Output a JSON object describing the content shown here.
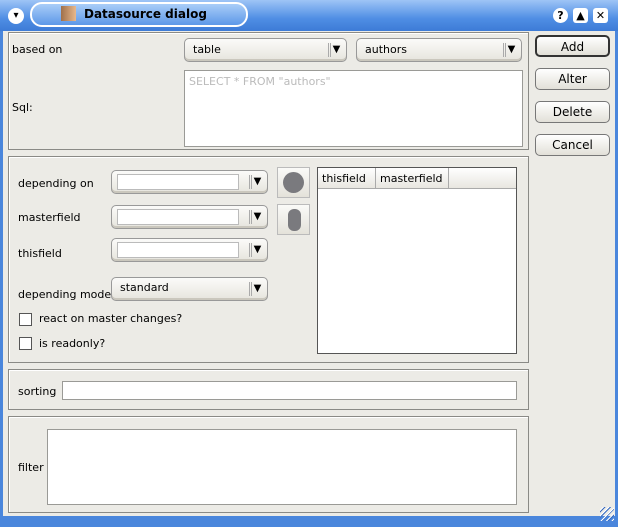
{
  "window": {
    "title": "Datasource dialog",
    "help": "?",
    "maximize": "▲",
    "close": "✕",
    "menu": "▾"
  },
  "top": {
    "based_on_label": "based on",
    "source_type": "table",
    "source_name": "authors",
    "sql_label": "Sql:",
    "sql_placeholder": "SELECT * FROM \"authors\""
  },
  "buttons": {
    "add": "Add",
    "alter": "Alter",
    "delete": "Delete",
    "cancel": "Cancel"
  },
  "relation": {
    "depending_on_label": "depending on",
    "depending_on": "",
    "masterfield_label": "masterfield",
    "masterfield": "",
    "thisfield_label": "thisfield",
    "thisfield": "",
    "mode_label": "depending mode",
    "mode": "standard",
    "react_label": "react on master changes?",
    "react_checked": false,
    "readonly_label": "is readonly?",
    "readonly_checked": false,
    "table_headers": [
      "thisfield",
      "masterfield"
    ]
  },
  "sorting": {
    "label": "sorting",
    "value": ""
  },
  "filter": {
    "label": "filter",
    "value": ""
  }
}
